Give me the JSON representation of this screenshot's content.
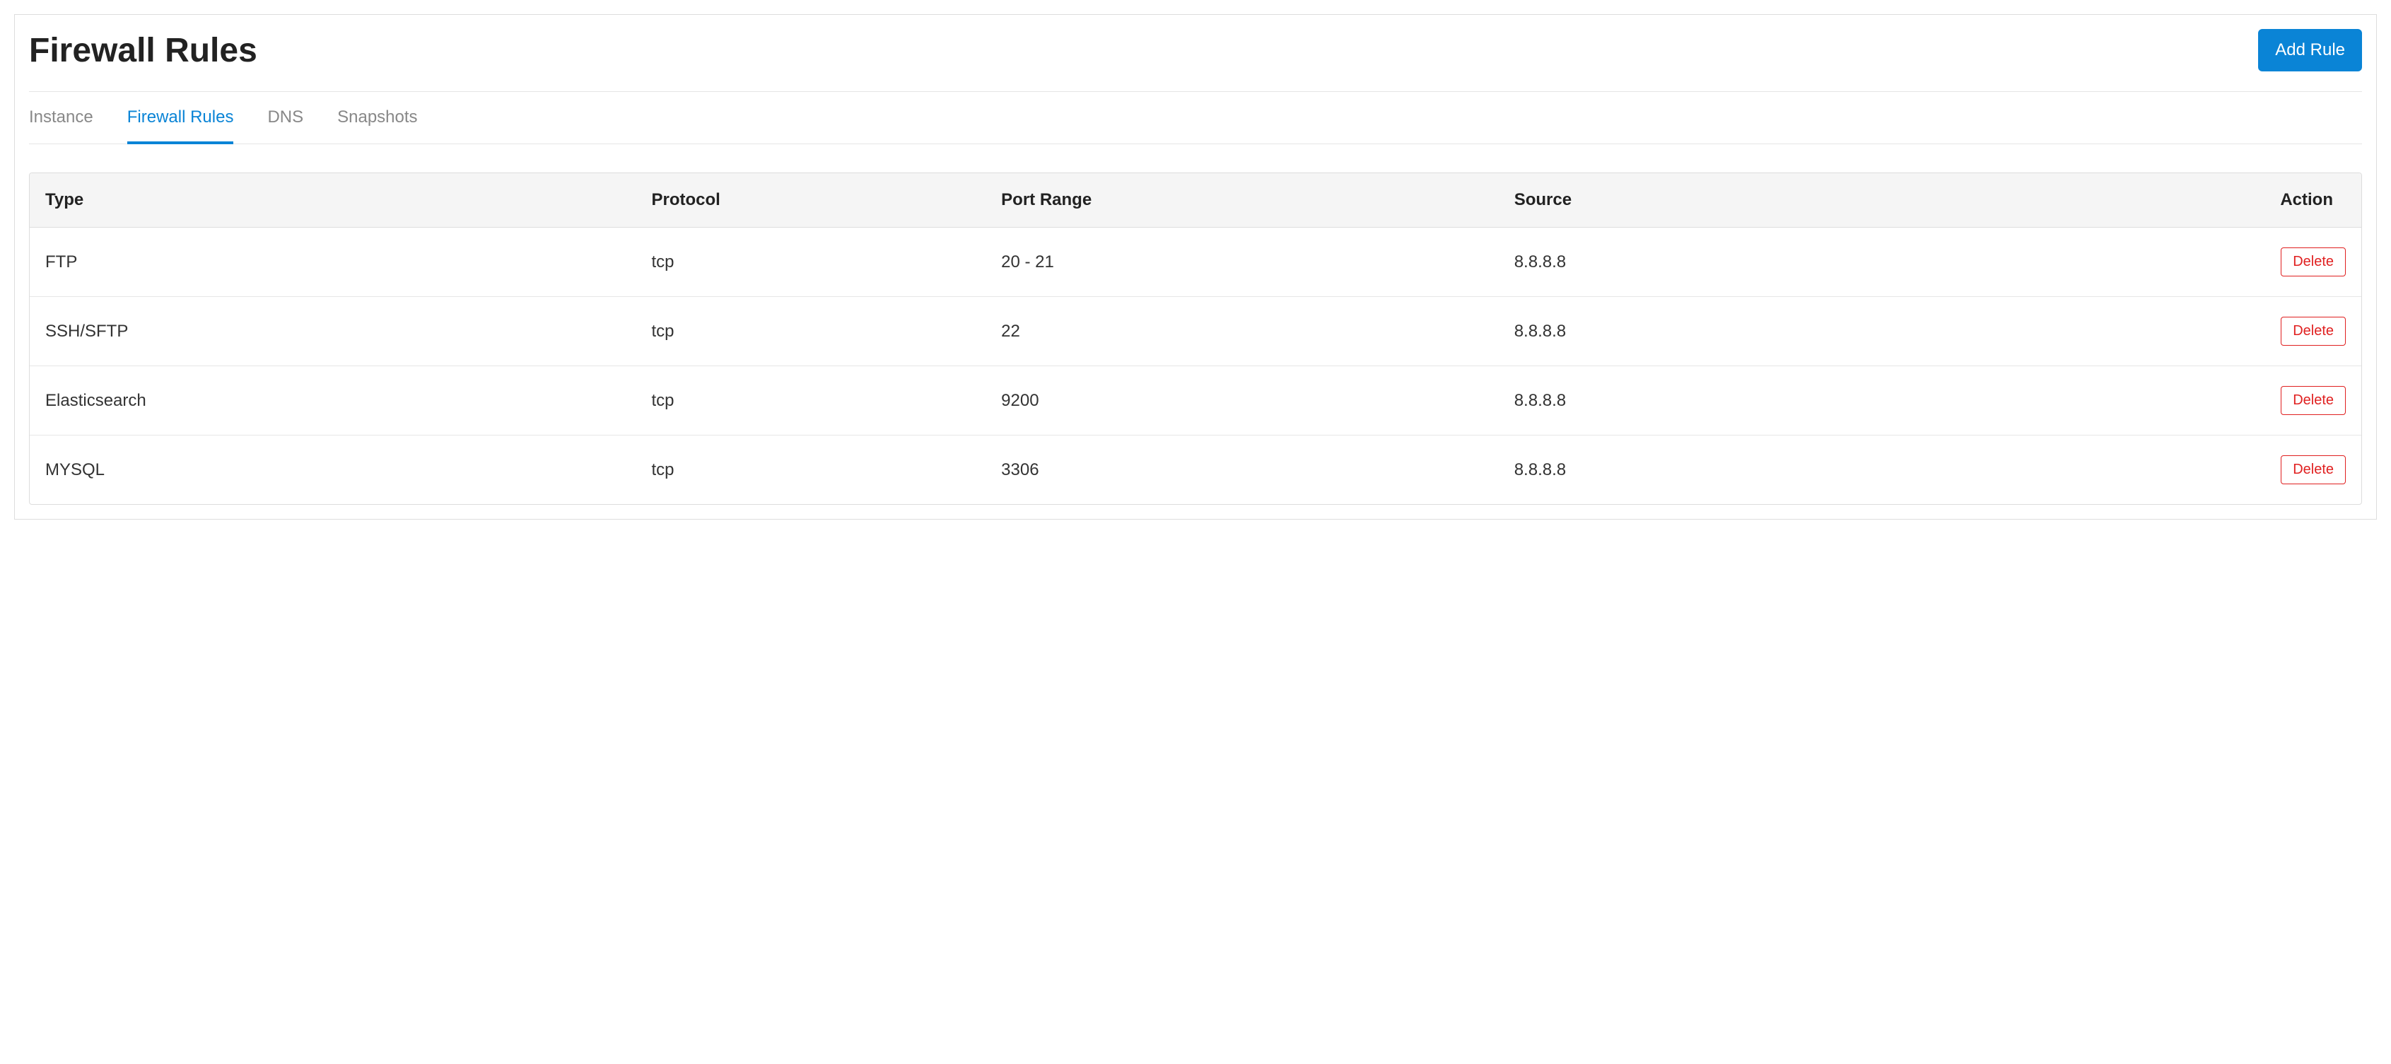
{
  "header": {
    "title": "Firewall Rules",
    "add_button_label": "Add Rule"
  },
  "tabs": [
    {
      "label": "Instance",
      "active": false
    },
    {
      "label": "Firewall Rules",
      "active": true
    },
    {
      "label": "DNS",
      "active": false
    },
    {
      "label": "Snapshots",
      "active": false
    }
  ],
  "table": {
    "columns": {
      "type": "Type",
      "protocol": "Protocol",
      "port_range": "Port Range",
      "source": "Source",
      "action": "Action"
    },
    "rows": [
      {
        "type": "FTP",
        "protocol": "tcp",
        "port_range": "20 - 21",
        "source": "8.8.8.8",
        "action_label": "Delete"
      },
      {
        "type": "SSH/SFTP",
        "protocol": "tcp",
        "port_range": "22",
        "source": "8.8.8.8",
        "action_label": "Delete"
      },
      {
        "type": "Elasticsearch",
        "protocol": "tcp",
        "port_range": "9200",
        "source": "8.8.8.8",
        "action_label": "Delete"
      },
      {
        "type": "MYSQL",
        "protocol": "tcp",
        "port_range": "3306",
        "source": "8.8.8.8",
        "action_label": "Delete"
      }
    ]
  }
}
